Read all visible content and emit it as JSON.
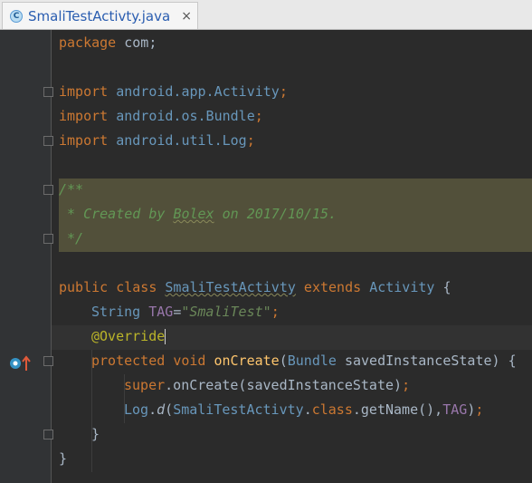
{
  "tab": {
    "icon_letter": "C",
    "filename": "SmaliTestActivty.java",
    "close_glyph": "×"
  },
  "code": {
    "l1": {
      "kw": "package",
      "pl": " com;"
    },
    "l3": {
      "kw": "import",
      "a": " android.",
      "b": "app.Activity",
      "c": ";"
    },
    "l4": {
      "kw": "import",
      "a": " android.",
      "b": "os.Bundle",
      "c": ";"
    },
    "l5": {
      "kw": "import",
      "a": " android.",
      "b": "util.Log",
      "c": ";"
    },
    "l7": "/**",
    "l8": {
      "a": " * Created by ",
      "author": "Bolex",
      "b": " on 2017/10/15."
    },
    "l9": " */",
    "l11": {
      "kw1": "public class ",
      "cls": "SmaliTestActivty",
      "kw2": " extends ",
      "parent": "Activity",
      "brace": " {"
    },
    "l12": {
      "type": "String",
      "field": " TAG",
      "eq": "=",
      "str": "\"SmaliTest\"",
      "semi": ";"
    },
    "l13": "@Override",
    "l14": {
      "kw1": "protected ",
      "kw2": "void ",
      "fn": "onCreate",
      "p1": "(",
      "type": "Bundle",
      "p2": " savedInstanceState) {"
    },
    "l15": {
      "kw": "super",
      "pl": ".onCreate(savedInstanceState)",
      "semi": ";"
    },
    "l16": {
      "log": "Log",
      "dot": ".",
      "d": "d",
      "p1": "(",
      "cls": "SmaliTestActivty",
      "dot2": ".",
      "kw": "class",
      "p2": ".getName(),",
      "fd": "TAG",
      "p3": ")",
      "semi": ";"
    },
    "l17": "}",
    "l18": "}"
  },
  "gutter_icon": "override-method-icon"
}
